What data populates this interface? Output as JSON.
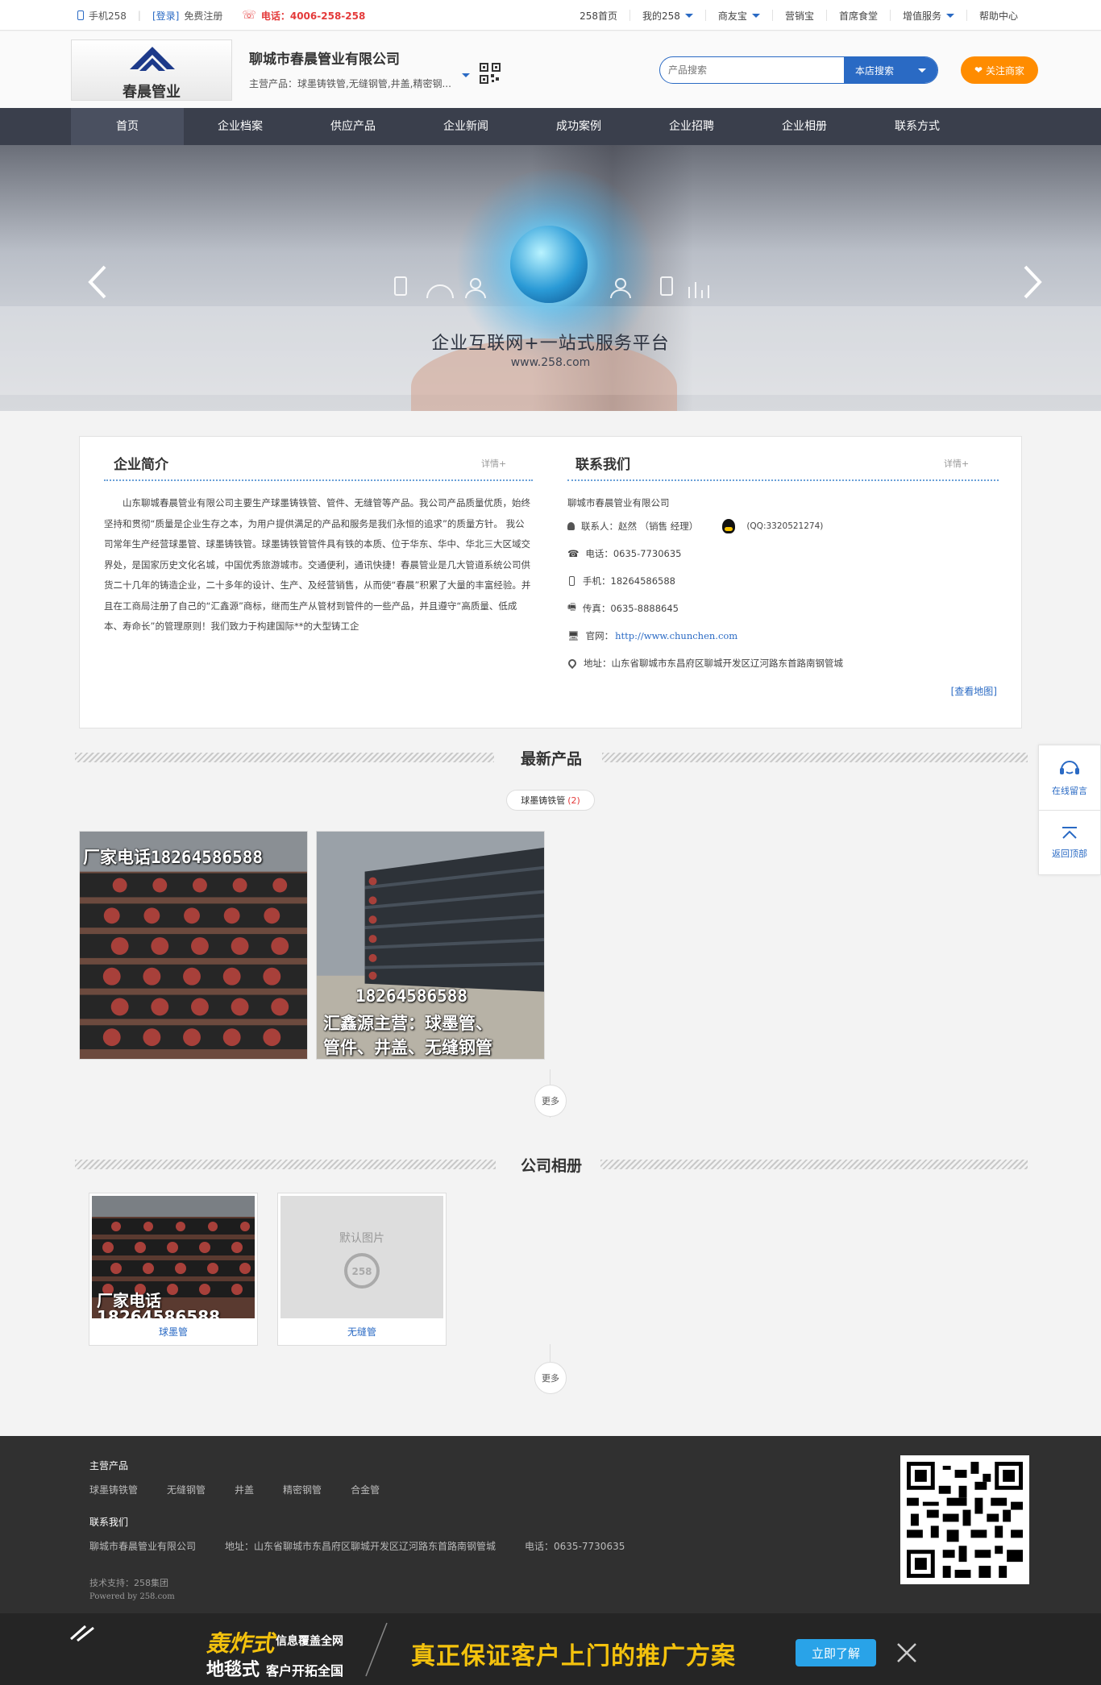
{
  "topbar": {
    "mobile": "手机258",
    "login": "[登录]",
    "register": "免费注册",
    "phone": "电话：4006-258-258",
    "links": [
      "258首页",
      "我的258",
      "商友宝",
      "营销宝",
      "首席食堂",
      "增值服务",
      "帮助中心"
    ]
  },
  "header": {
    "logo_text": "春晨管业",
    "company_name": "聊城市春晨管业有限公司",
    "main_products": "主营产品：球墨铸铁管,无缝钢管,井盖,精密钢...",
    "search_placeholder": "产品搜索",
    "search_button": "本店搜索",
    "follow_button": "关注商家"
  },
  "nav": [
    "首页",
    "企业档案",
    "供应产品",
    "企业新闻",
    "成功案例",
    "企业招聘",
    "企业相册",
    "联系方式"
  ],
  "banner": {
    "tagline": "企业互联网+一站式服务平台",
    "url": "www.258.com"
  },
  "intro": {
    "title": "企业简介",
    "more": "详情+",
    "text": "山东聊城春晨管业有限公司主要生产球墨铸铁管、管件、无缝管等产品。我公司产品质量优质，始终坚持和贯彻“质量是企业生存之本，为用户提供满足的产品和服务是我们永恒的追求”的质量方针。        我公司常年生产经营球墨管、球墨铸铁管。球墨铸铁管管件具有铁的本质、位于华东、华中、华北三大区域交界处，是国家历史文化名城，中国优秀旅游城市。交通便利，通讯快捷！春晨管业是几大管道系统公司供货二十几年的铸造企业，二十多年的设计、生产、及经营销售，从而使“春晨”积累了大量的丰富经验。并且在工商局注册了自己的“汇鑫源”商标，继而生产从管材到管件的一些产品，并且遵守“高质量、低成本、寿命长”的管理原则！我们致力于构建国际**的大型铸工企"
  },
  "contact": {
    "title": "联系我们",
    "more": "详情+",
    "company": "聊城市春晨管业有限公司",
    "person": "联系人：赵然 （销售  经理）",
    "qq": "(QQ:3320521274)",
    "tel": "电话：0635-7730635",
    "mobile": "手机：18264586588",
    "fax": "传真：0635-8888645",
    "site_label": "官网：",
    "site_url": "http://www.chunchen.com",
    "address": "地址：山东省聊城市东昌府区聊城开发区辽河路东首路南钢管城",
    "map": "[查看地图]"
  },
  "products": {
    "title": "最新产品",
    "category": "球墨铸铁管",
    "category_count": "(2)",
    "items": [
      {
        "overlay_top": "厂家电话18264586588"
      },
      {
        "overlay_phone": "18264586588",
        "overlay_l1": "汇鑫源主营：球墨管、",
        "overlay_l2": "管件、井盖、无缝钢管"
      }
    ],
    "more": "更多"
  },
  "album": {
    "title": "公司相册",
    "items": [
      {
        "caption": "球墨管",
        "overlay": "厂家电话",
        "overlay2": "18264586588"
      },
      {
        "caption": "无缝管",
        "default_text": "默认图片",
        "default_logo": "258"
      }
    ],
    "more": "更多"
  },
  "float": {
    "message": "在线留言",
    "top": "返回顶部"
  },
  "footer": {
    "main_products_title": "主营产品",
    "main_products": [
      "球墨铸铁管",
      "无缝钢管",
      "井盖",
      "精密钢管",
      "合金管"
    ],
    "contact_title": "联系我们",
    "company": "聊城市春晨管业有限公司",
    "address": "地址：山东省聊城市东昌府区聊城开发区辽河路东首路南钢管城",
    "tel": "电话：0635-7730635",
    "support": "技术支持：258集团",
    "powered": "Powered by 258.com"
  },
  "ad": {
    "l1": "轰炸式",
    "l1b": "信息覆盖全网",
    "l2": "地毯式",
    "l2b": "客户开拓全国",
    "slogan": "真正保证客户上门的推广方案",
    "cta": "立即了解"
  },
  "colors": {
    "brand": "#2a6ac4",
    "follow": "#ff8c00",
    "nav": "#3a3f4c",
    "footer": "#303030",
    "ad_yellow": "#f4c20d"
  }
}
